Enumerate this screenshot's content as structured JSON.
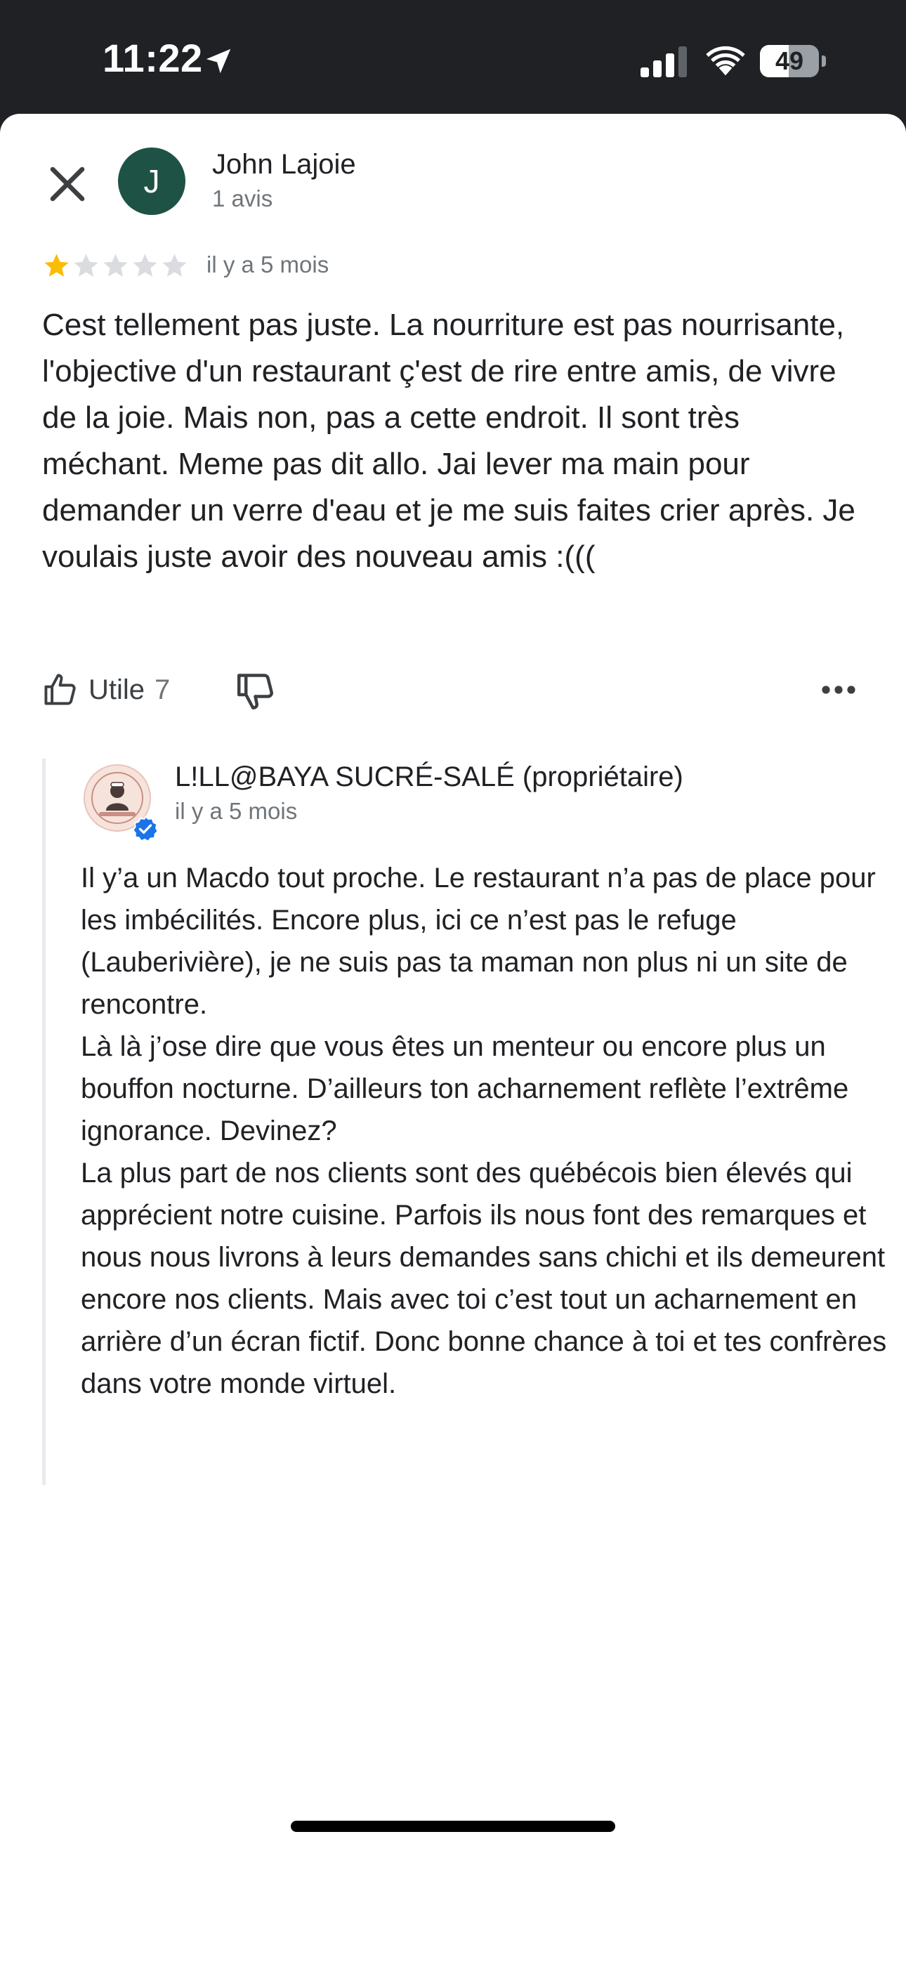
{
  "status_bar": {
    "time": "11:22",
    "battery_percent": 49,
    "battery_label": "49",
    "location_icon": "location-arrow-icon",
    "signal_icon": "cellular-signal-icon",
    "wifi_icon": "wifi-icon"
  },
  "review": {
    "close_icon": "close-icon",
    "avatar_letter": "J",
    "reviewer_name": "John Lajoie",
    "reviewer_review_count": "1 avis",
    "rating": 1,
    "rating_max": 5,
    "date": "il y a 5 mois",
    "text": "Cest tellement pas juste. La nourriture est pas nourrisante, l'objective d'un restaurant ç'est de rire entre amis, de vivre de la joie. Mais non, pas a cette endroit. Il sont très méchant. Meme pas dit allo. Jai lever ma main pour demander un verre d'eau et je me suis faites crier après. Je voulais juste avoir des nouveau amis :(((",
    "helpful_label": "Utile",
    "helpful_count": "7"
  },
  "owner_reply": {
    "name": "L!LL@BAYA SUCRÉ-SALÉ (propriétaire)",
    "date": "il y a 5 mois",
    "paragraphs": [
      "Il y’a un Macdo tout proche. Le restaurant n’a pas de place pour les imbécilités. Encore plus, ici ce n’est pas le refuge (Lauberivière), je ne suis pas ta maman non plus ni un site de rencontre.",
      "Là là j’ose dire que vous êtes un menteur ou encore plus un bouffon nocturne. D’ailleurs ton acharnement reflète l’extrême ignorance. Devinez?",
      "La plus part de nos clients sont des québécois bien élevés qui apprécient notre cuisine. Parfois ils nous font des remarques et nous nous livrons à leurs demandes sans chichi et ils demeurent encore nos clients. Mais avec toi c’est tout un acharnement en arrière d’un écran fictif. Donc bonne chance à toi et tes confrères dans votre monde virtuel."
    ]
  },
  "colors": {
    "avatar_bg": "#1e5245",
    "star_filled": "#fbbc04",
    "star_empty": "#dadce0",
    "verified": "#1a73e8",
    "status_bar_bg": "#202124"
  }
}
